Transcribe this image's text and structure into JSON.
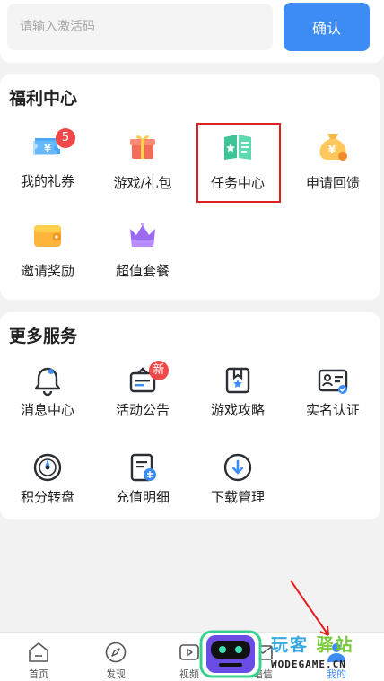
{
  "redeem": {
    "placeholder": "请输入激活码",
    "confirm_label": "确认"
  },
  "welfare": {
    "title": "福利中心",
    "items": [
      {
        "label": "我的礼券",
        "icon": "ticket-icon",
        "badge": "5"
      },
      {
        "label": "游戏/礼包",
        "icon": "gift-box-icon"
      },
      {
        "label": "任务中心",
        "icon": "task-book-icon"
      },
      {
        "label": "申请回馈",
        "icon": "money-bag-icon"
      },
      {
        "label": "邀请奖励",
        "icon": "wallet-icon"
      },
      {
        "label": "超值套餐",
        "icon": "crown-icon"
      }
    ]
  },
  "services": {
    "title": "更多服务",
    "items": [
      {
        "label": "消息中心",
        "icon": "bell-icon"
      },
      {
        "label": "活动公告",
        "icon": "announcement-icon",
        "badge": "新"
      },
      {
        "label": "游戏攻略",
        "icon": "guide-bookmark-icon"
      },
      {
        "label": "实名认证",
        "icon": "id-card-icon"
      },
      {
        "label": "积分转盘",
        "icon": "turntable-icon"
      },
      {
        "label": "充值明细",
        "icon": "recharge-record-icon"
      },
      {
        "label": "下载管理",
        "icon": "download-icon"
      }
    ]
  },
  "tabbar": {
    "items": [
      {
        "label": "首页",
        "icon": "home-icon"
      },
      {
        "label": "发现",
        "icon": "compass-icon"
      },
      {
        "label": "视频",
        "icon": "video-icon"
      },
      {
        "label": "暗信",
        "icon": "mail-icon"
      },
      {
        "label": "我的",
        "icon": "user-icon",
        "active": true
      }
    ]
  },
  "watermark": {
    "cn_part1": "玩客",
    "cn_part2": "驿站",
    "en": "WODEGAME.CN"
  },
  "colors": {
    "accent": "#3d8cf5",
    "highlight_box": "#e02020",
    "arrow": "#e02020",
    "badge": "#f04848"
  }
}
